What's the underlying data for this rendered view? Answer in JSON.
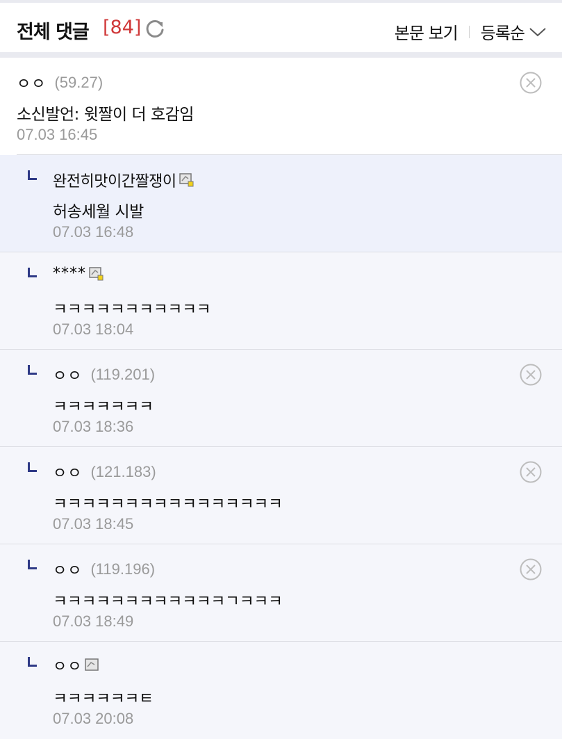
{
  "header": {
    "title": "전체 댓글",
    "count": "[84]",
    "view_body_label": "본문 보기",
    "sort_label": "등록순"
  },
  "colors": {
    "accent": "#d0393a",
    "reply_marker": "#2f3a86",
    "muted": "#9a9a9a"
  },
  "comments": [
    {
      "author": "ㅇㅇ",
      "ip": "(59.27)",
      "text": "소신발언: 윗짤이 더 호감임",
      "date": "07.03 16:45",
      "reply": false,
      "member_icon": false,
      "deletable": true
    },
    {
      "author": "완전히맛이간짤쟁이",
      "ip": "",
      "text": "허송세월 시발",
      "date": "07.03 16:48",
      "reply": true,
      "member_icon": true,
      "deletable": false
    },
    {
      "author": "****",
      "ip": "",
      "text": "ㅋㅋㅋㅋㅋㅋㅋㅋㅋㅋㅋ",
      "date": "07.03 18:04",
      "reply": true,
      "member_icon": true,
      "deletable": false
    },
    {
      "author": "ㅇㅇ",
      "ip": "(119.201)",
      "text": "ㅋㅋㅋㅋㅋㅋㅋ",
      "date": "07.03 18:36",
      "reply": true,
      "member_icon": false,
      "deletable": true
    },
    {
      "author": "ㅇㅇ",
      "ip": "(121.183)",
      "text": "ㅋㅋㅋㅋㅋㅋㅋㅋㅋㅋㅋㅋㅋㅋㅋㅋ",
      "date": "07.03 18:45",
      "reply": true,
      "member_icon": false,
      "deletable": true
    },
    {
      "author": "ㅇㅇ",
      "ip": "(119.196)",
      "text": "ㅋㅋㅋㅋㅋㅋㅋㅋㅋㅋㅋㅋㄱㅋㅋㅋ",
      "date": "07.03 18:49",
      "reply": true,
      "member_icon": false,
      "deletable": true
    },
    {
      "author": "ㅇㅇ",
      "ip": "",
      "text": "ㅋㅋㅋㅋㅋㅋㅌ",
      "date": "07.03 20:08",
      "reply": true,
      "member_icon": true,
      "deletable": false
    }
  ]
}
